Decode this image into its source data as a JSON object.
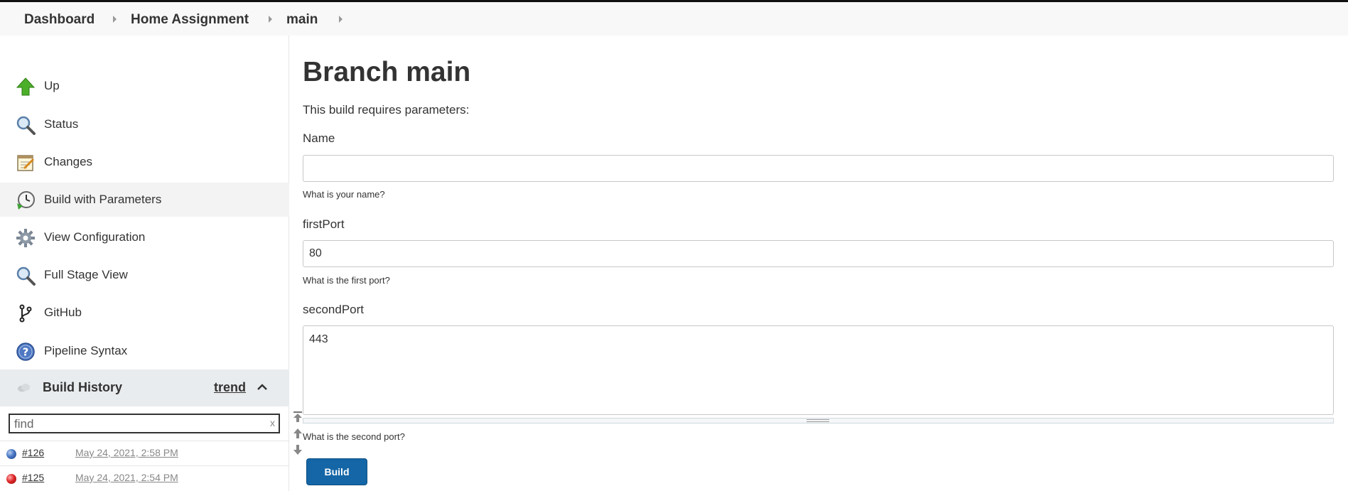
{
  "breadcrumb": {
    "items": [
      "Dashboard",
      "Home Assignment",
      "main"
    ]
  },
  "sidebar": {
    "tasks": [
      {
        "label": "Up",
        "icon": "up-arrow-icon"
      },
      {
        "label": "Status",
        "icon": "magnifier-icon"
      },
      {
        "label": "Changes",
        "icon": "notepad-icon"
      },
      {
        "label": "Build with Parameters",
        "icon": "clock-icon"
      },
      {
        "label": "View Configuration",
        "icon": "gear-icon"
      },
      {
        "label": "Full Stage View",
        "icon": "magnifier-icon"
      },
      {
        "label": "GitHub",
        "icon": "branch-icon"
      },
      {
        "label": "Pipeline Syntax",
        "icon": "help-icon"
      }
    ],
    "active_task": "Build with Parameters"
  },
  "build_history": {
    "title": "Build History",
    "trend_label": "trend",
    "search_placeholder": "find",
    "clear_label": "x",
    "builds": [
      {
        "number": "#126",
        "date": "May 24, 2021, 2:58 PM",
        "status": "success",
        "color": "#4a78c4"
      },
      {
        "number": "#125",
        "date": "May 24, 2021, 2:54 PM",
        "status": "failed",
        "color": "#e0282a"
      }
    ]
  },
  "main": {
    "title": "Branch main",
    "intro": "This build requires parameters:",
    "params": [
      {
        "label": "Name",
        "value": "",
        "help": "What is your name?"
      },
      {
        "label": "firstPort",
        "value": "80",
        "help": "What is the first port?"
      },
      {
        "label": "secondPort",
        "value": "443",
        "help": "What is the second port?"
      }
    ],
    "build_button": "Build"
  },
  "colors": {
    "primary_button": "#1466a6",
    "breadcrumb_bg": "#f8f8f8",
    "history_header_bg": "#e9ecee"
  }
}
